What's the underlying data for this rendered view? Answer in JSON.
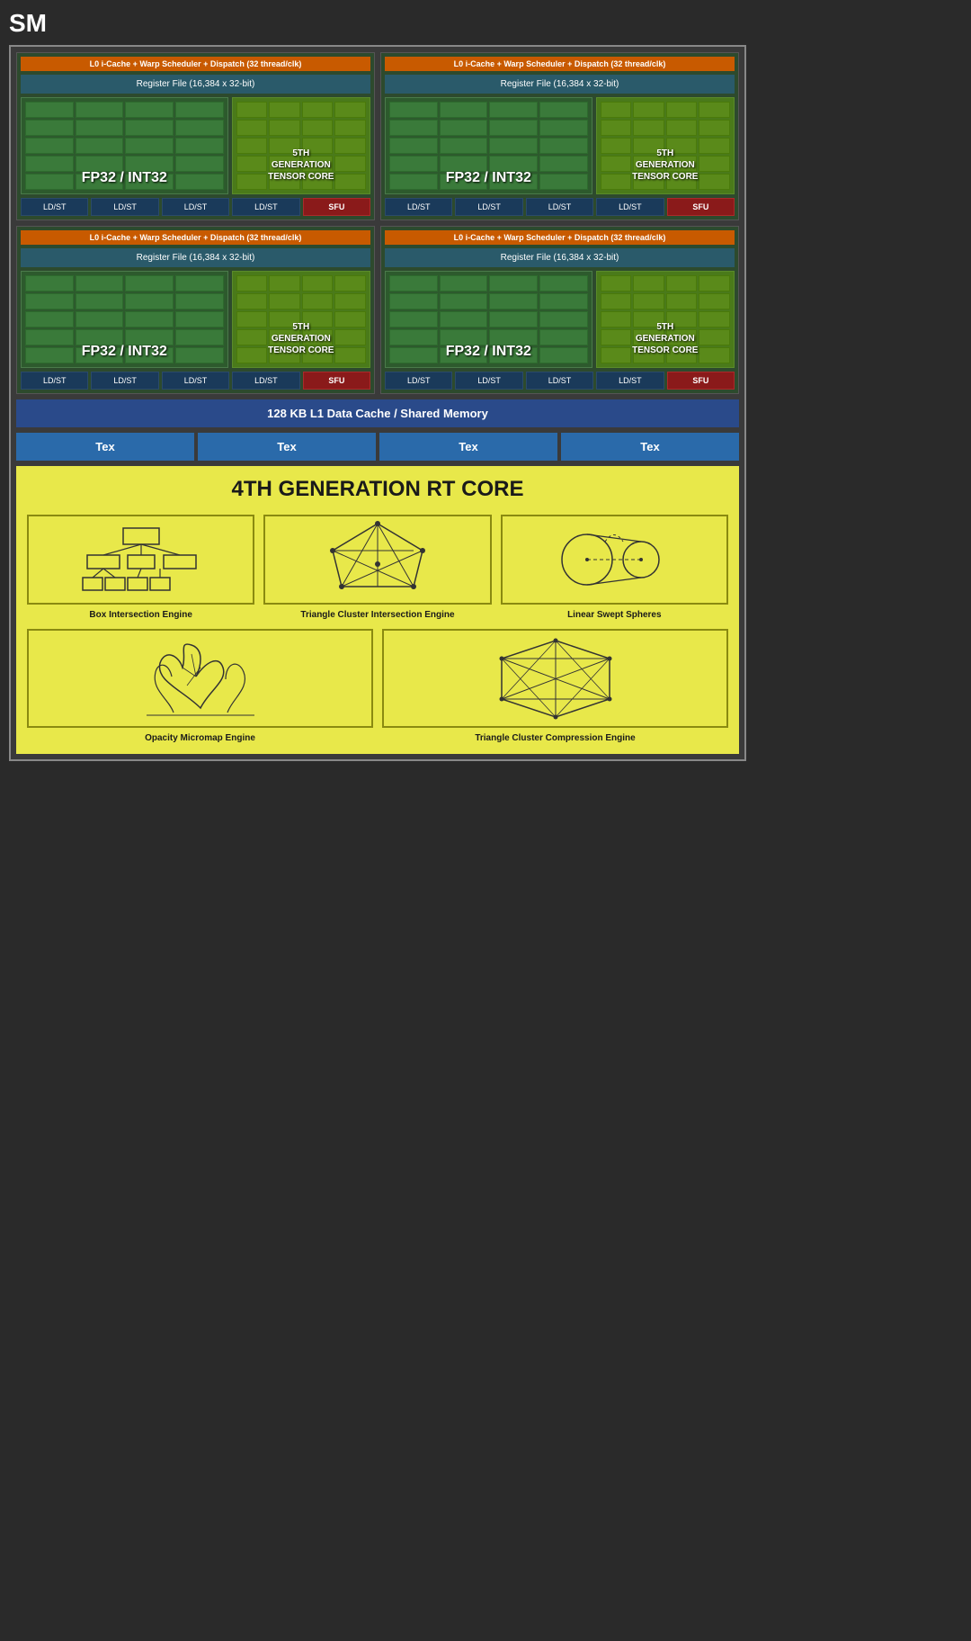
{
  "title": "SM",
  "quadrants": [
    {
      "warp": "L0 i-Cache + Warp Scheduler + Dispatch (32 thread/clk)",
      "register": "Register File (16,384 x 32-bit)",
      "fp32_label": "FP32 / INT32",
      "tensor_label": "5TH\nGENERATION\nTENSOR CORE",
      "ldst": [
        "LD/ST",
        "LD/ST",
        "LD/ST",
        "LD/ST"
      ],
      "sfu": "SFU"
    },
    {
      "warp": "L0 i-Cache + Warp Scheduler + Dispatch (32 thread/clk)",
      "register": "Register File (16,384 x 32-bit)",
      "fp32_label": "FP32 / INT32",
      "tensor_label": "5TH\nGENERATION\nTENSOR CORE",
      "ldst": [
        "LD/ST",
        "LD/ST",
        "LD/ST",
        "LD/ST"
      ],
      "sfu": "SFU"
    },
    {
      "warp": "L0 i-Cache + Warp Scheduler + Dispatch (32 thread/clk)",
      "register": "Register File (16,384 x 32-bit)",
      "fp32_label": "FP32 / INT32",
      "tensor_label": "5TH\nGENERATION\nTENSOR CORE",
      "ldst": [
        "LD/ST",
        "LD/ST",
        "LD/ST",
        "LD/ST"
      ],
      "sfu": "SFU"
    },
    {
      "warp": "L0 i-Cache + Warp Scheduler + Dispatch (32 thread/clk)",
      "register": "Register File (16,384 x 32-bit)",
      "fp32_label": "FP32 / INT32",
      "tensor_label": "5TH\nGENERATION\nTENSOR CORE",
      "ldst": [
        "LD/ST",
        "LD/ST",
        "LD/ST",
        "LD/ST"
      ],
      "sfu": "SFU"
    }
  ],
  "l1_cache": "128 KB L1 Data Cache / Shared Memory",
  "tex_units": [
    "Tex",
    "Tex",
    "Tex",
    "Tex"
  ],
  "rt_core": {
    "title": "4TH GENERATION RT CORE",
    "engines_top": [
      {
        "label": "Box Intersection Engine"
      },
      {
        "label": "Triangle Cluster Intersection Engine"
      },
      {
        "label": "Linear Swept Spheres"
      }
    ],
    "engines_bottom": [
      {
        "label": "Opacity Micromap Engine"
      },
      {
        "label": "Triangle Cluster Compression Engine"
      }
    ]
  }
}
